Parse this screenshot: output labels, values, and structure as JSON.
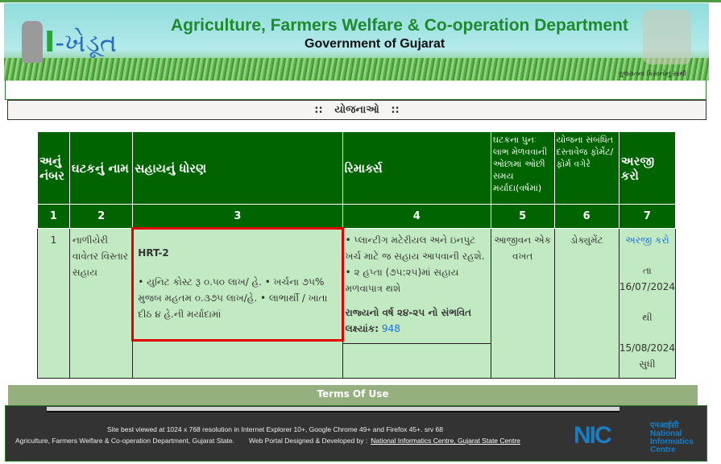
{
  "header": {
    "title": "Agriculture, Farmers Welfare & Co-operation Department",
    "subtitle": "Government of Gujarat",
    "logo_text": "I-ખેડૂત",
    "tagline": "ગુજરાતના કિસાનોનું સાથી"
  },
  "section_title": "::   યોજનાઓ   ::",
  "table": {
    "headers": [
      "અનું નંબર",
      "ઘટકનું નામ",
      "સહાયનું ધોરણ",
      "રિમાર્ક્સ",
      "ઘટકના પુનઃ લાભ મેળવવાની ઓછામાં ઓછી સમય મર્યાદા(વર્ષમાં)",
      "યોજના સંબંધિત દસ્તાવેજ ફોર્મેટ/ફોર્મ વગેરે",
      "અરજી કરો"
    ],
    "numbers": [
      "1",
      "2",
      "3",
      "4",
      "5",
      "6",
      "7"
    ],
    "rows": [
      {
        "sr": "1",
        "name": "નાળીયેરી વાવેતર વિસ્તાર સહાય",
        "code": "HRT-2",
        "standard": "• યુનિટ કોસ્ટ રૂ ૦.૫૦ લાખ/ હે. • ખર્ચના ૭૫% મુજબ મહતમ ૦.૩૭૫ લાખ/હે. • લાભાર્થી / ખાતા દીઠ ૪ હે.ની મર્યાદામાં",
        "remarks": "• પ્લાન્ટીગ મટેરીયલ અને ઇનપુટ ખર્ચ માટે જ સહાય આપવાની રહશે. • ૨ હપ્તા (૭૫:૨૫)માં સહાય મળવાપાત્ર થશે",
        "target_label": "રાજ્યનો વર્ષ ૨૪-૨૫ નો સંભવિત લક્ષ્યાંક:",
        "target_value": "948",
        "time_limit": "આજીવન એક વખત",
        "document": "ડોક્યુમેંટ",
        "apply": "અરજી કરો",
        "from_label": "તા",
        "from_date": "16/07/2024",
        "to_label": "થી",
        "to_date": "15/08/2024",
        "until": "સુધી"
      }
    ]
  },
  "terms": "Terms Of Use",
  "footer": {
    "line1": "Site best viewed at 1024 x 768 resolution in Internet Explorer 10+, Google Chrome 49+ and Firefox 45+. srv 68",
    "line2": "Agriculture, Farmers Welfare & Co-operation Department, Gujarat State.",
    "developed": "Web Portal Designed & Developed by :",
    "link": "National Informatics Centre, Gujarat State Centre",
    "nic_logo": "NIC",
    "nic_hindi": "एनआईसी",
    "nic_name": "National Informatics Centre"
  },
  "colors": {
    "header_green": "#006400",
    "row_bg": "#c2eac2",
    "highlight": "#e00000",
    "link": "#1a6fe0"
  }
}
